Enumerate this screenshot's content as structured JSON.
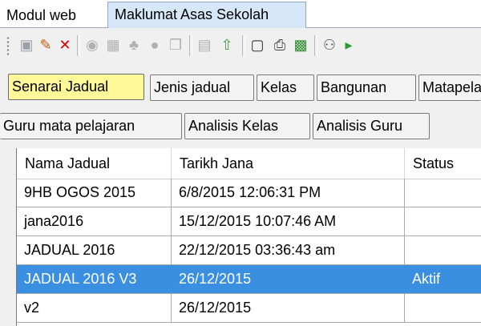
{
  "top_tabs": [
    "Modul web",
    "Maklumat Asas Sekolah"
  ],
  "toolbar": {
    "icons": [
      {
        "name": "new-document-icon",
        "glyph": "▣",
        "color": "#9aa0a8"
      },
      {
        "name": "edit-pencil-icon",
        "glyph": "✎",
        "color": "#c85a12"
      },
      {
        "name": "delete-x-icon",
        "glyph": "✕",
        "color": "#e00000"
      },
      {
        "name": "disabled-icon",
        "glyph": "◉",
        "color": "#b0b0b0"
      },
      {
        "name": "table-icon",
        "glyph": "▦",
        "color": "#b0b0b0"
      },
      {
        "name": "users-icon",
        "glyph": "♣",
        "color": "#b0b0b0"
      },
      {
        "name": "stop-icon",
        "glyph": "●",
        "color": "#b0b0b0"
      },
      {
        "name": "copy-icon",
        "glyph": "❐",
        "color": "#b0b0b0"
      },
      {
        "name": "save-icon",
        "glyph": "▤",
        "color": "#b0b0b0"
      },
      {
        "name": "arrow-dropdown-icon",
        "glyph": "⇧",
        "color": "#3c9a3c"
      },
      {
        "name": "page-setup-icon",
        "glyph": "▢",
        "color": "#333333"
      },
      {
        "name": "print-icon",
        "glyph": "⎙",
        "color": "#444444"
      },
      {
        "name": "excel-export-icon",
        "glyph": "▩",
        "color": "#2e8b2e"
      },
      {
        "name": "find-binoculars-icon",
        "glyph": "⚇",
        "color": "#555555"
      },
      {
        "name": "find-next-icon",
        "glyph": "▸",
        "color": "#2e9b2e"
      }
    ]
  },
  "sub_tabs_row1": [
    "Senarai Jadual",
    "Jenis jadual",
    "Kelas",
    "Bangunan",
    "Matapelajaran"
  ],
  "sub_tabs_row2": [
    "Guru mata pelajaran",
    "Analisis Kelas",
    "Analisis Guru"
  ],
  "grid": {
    "columns": [
      "Nama Jadual",
      "Tarikh Jana",
      "Status"
    ],
    "rows": [
      [
        "9HB OGOS 2015",
        "6/8/2015 12:06:31 PM",
        ""
      ],
      [
        "jana2016",
        "15/12/2015 10:07:46 AM",
        ""
      ],
      [
        "JADUAL 2016",
        "22/12/2015 03:36:43 am",
        ""
      ],
      [
        "JADUAL 2016 V3",
        "26/12/2015",
        "Aktif"
      ],
      [
        "v2",
        "26/12/2015",
        ""
      ]
    ],
    "selected_row": 3
  },
  "colors": {
    "selected_tab": "#fff99a",
    "selected_row": "#3b8fe0",
    "active_top_tab": "#d6e8f7"
  }
}
